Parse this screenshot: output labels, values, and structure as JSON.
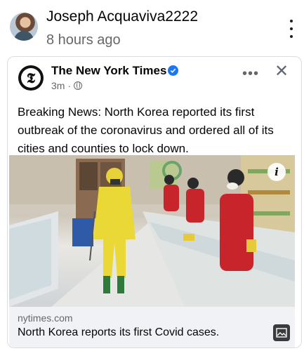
{
  "post": {
    "author": "Joseph Acquaviva2222",
    "time": "8 hours ago",
    "more_icon": "vertical-ellipsis-icon"
  },
  "shared": {
    "page_name": "The New York Times",
    "time": "3m",
    "separator": "·",
    "privacy_icon": "globe-icon",
    "more_icon": "horizontal-ellipsis-icon",
    "close_icon": "close-icon",
    "more_glyph": "•••",
    "close_glyph": "✕",
    "body": "Breaking News: North Korea reported its first outbreak of the coronavirus and ordered all of its cities and counties to lock down.",
    "image_alt": "Worker in yellow protective suit spraying disinfectant in a store while clerks in red uniforms clean counters",
    "info_glyph": "i",
    "link": {
      "domain": "nytimes.com",
      "headline": "North Korea reports its first Covid cases."
    }
  },
  "colors": {
    "accent": "#1877f2",
    "muted": "#65676b",
    "footer_bg": "#f0f2f5"
  }
}
